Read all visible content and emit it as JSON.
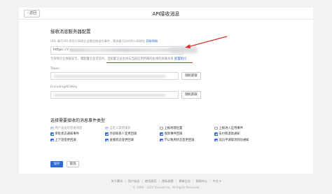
{
  "header": {
    "back_label": "返回",
    "title": "API接收消息"
  },
  "server_config": {
    "title": "接收消息服务器配置",
    "url_label": "URL",
    "url_hint": "填写URL将用于接收企业微信推送的事件，需具备可访问的公网地址",
    "url_hint_link": "获取帮助",
    "url_value": "https://",
    "ip_hint_prefix": "为保障企业数据安全，",
    "ip_hint_main": "需配置企业可信IP，且配置企业主体与当前应用所属的主体的关联关系",
    "ip_hint_link": "配置指引",
    "token_label": "Token",
    "token_button": "随机获取",
    "aeskey_label": "EncodingAESKey",
    "aeskey_button": "随机获取"
  },
  "events": {
    "title": "选择需要接收的消息事件类型",
    "items": [
      {
        "label": "用户发送的普通消息",
        "checked": true,
        "disabled": true
      },
      {
        "label": "自定义菜单操作",
        "checked": true,
        "disabled": true
      },
      {
        "label": "上报地理位置",
        "checked": false,
        "disabled": false
      },
      {
        "label": "上报进入应用事件",
        "checked": false,
        "disabled": false
      },
      {
        "label": "审批状态通知事件",
        "checked": true,
        "disabled": false
      },
      {
        "label": "外部联系人变更回调",
        "checked": true,
        "disabled": false
      },
      {
        "label": "收款事件回调",
        "checked": true,
        "disabled": false
      },
      {
        "label": "支付和退款通知",
        "checked": true,
        "disabled": false
      },
      {
        "label": "上下游变更回调",
        "checked": true,
        "disabled": false
      },
      {
        "label": "直播状态变更回调",
        "checked": true,
        "disabled": false
      },
      {
        "label": "学以致用状态变更回调",
        "checked": true,
        "disabled": false
      },
      {
        "label": "成员申请取消到访通知",
        "checked": true,
        "disabled": false
      }
    ]
  },
  "actions": {
    "save_label": "保存",
    "cancel_label": "取消"
  },
  "footer": {
    "links": [
      "关于腾讯",
      "用户协议",
      "使用规范",
      "隐私政策",
      "更新日志",
      "帮助中心",
      "中文"
    ],
    "copyright": "© 1998 - 2024 Tencent Inc. All Rights Reserved"
  },
  "colors": {
    "accent": "#2e6ad1",
    "highlight": "#e0302a",
    "page_bg": "#f1f2f4"
  }
}
